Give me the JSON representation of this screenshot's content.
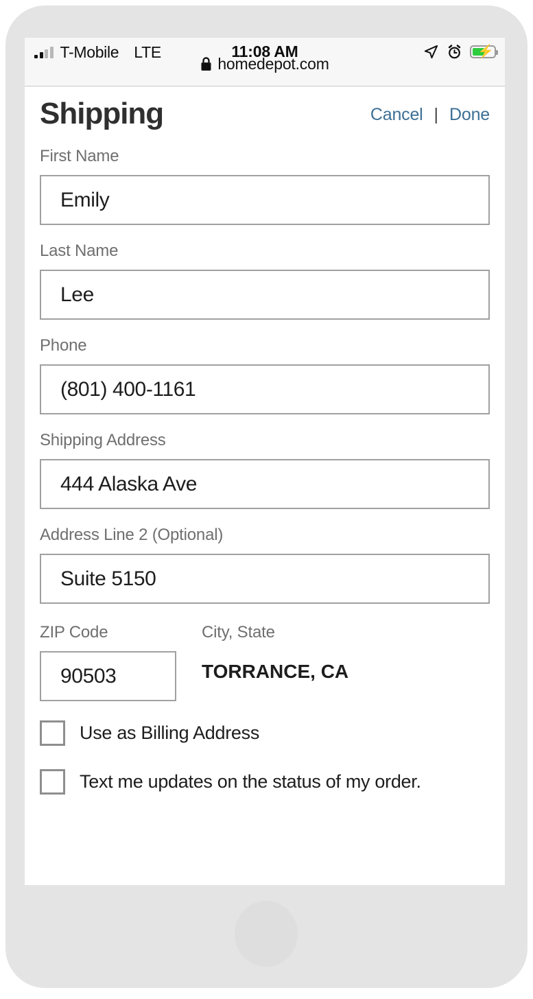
{
  "status_bar": {
    "carrier": "T-Mobile",
    "network": "LTE",
    "time": "11:08 AM",
    "icons": {
      "signal": "signal-bars-icon",
      "location": "location-arrow-icon",
      "alarm": "alarm-clock-icon",
      "battery": "battery-charging-icon"
    },
    "colors": {
      "battery_fill": "#2ecc3f"
    }
  },
  "browser": {
    "lock_icon": "lock-icon",
    "url": "homedepot.com"
  },
  "header": {
    "title": "Shipping",
    "cancel_label": "Cancel",
    "divider": "|",
    "done_label": "Done",
    "link_color": "#3c6f95"
  },
  "form": {
    "fields": [
      {
        "label": "First Name",
        "value": "Emily"
      },
      {
        "label": "Last Name",
        "value": "Lee"
      },
      {
        "label": "Phone",
        "value": "(801) 400-1161"
      },
      {
        "label": "Shipping Address",
        "value": "444 Alaska Ave"
      },
      {
        "label": "Address Line 2 (Optional)",
        "value": "Suite 5150"
      }
    ],
    "zip": {
      "label": "ZIP Code",
      "value": "90503"
    },
    "city_state": {
      "label": "City, State",
      "value": "TORRANCE, CA"
    },
    "checkboxes": [
      {
        "label": "Use as Billing Address",
        "checked": false
      },
      {
        "label": "Text me updates on the status of my order.",
        "checked": false
      }
    ]
  }
}
